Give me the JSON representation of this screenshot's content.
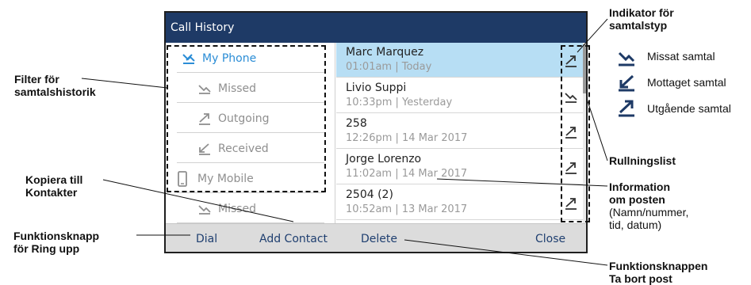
{
  "screen": {
    "title": "Call History",
    "filters": [
      {
        "label": "My Phone",
        "icon": "all-calls-icon",
        "active": true
      },
      {
        "label": "Missed",
        "icon": "missed-call-icon",
        "active": false
      },
      {
        "label": "Outgoing",
        "icon": "outgoing-call-icon",
        "active": false
      },
      {
        "label": "Received",
        "icon": "received-call-icon",
        "active": false
      },
      {
        "label": "My Mobile",
        "icon": "mobile-phone-icon",
        "active": false
      },
      {
        "label": "Missed",
        "icon": "missed-call-icon",
        "active": false
      }
    ],
    "entries": [
      {
        "name": "Marc Marquez",
        "meta": "01:01am | Today",
        "type": "outgoing",
        "selected": true
      },
      {
        "name": "Livio Suppi",
        "meta": "10:33pm | Yesterday",
        "type": "missed",
        "selected": false
      },
      {
        "name": "258",
        "meta": "12:26pm | 14 Mar 2017",
        "type": "outgoing",
        "selected": false
      },
      {
        "name": "Jorge Lorenzo",
        "meta": "11:02am | 14 Mar 2017",
        "type": "outgoing",
        "selected": false
      },
      {
        "name": "2504 (2)",
        "meta": "10:52am | 13 Mar 2017",
        "type": "outgoing",
        "selected": false
      }
    ],
    "softkeys": {
      "dial": "Dial",
      "add_contact": "Add Contact",
      "delete": "Delete",
      "close": "Close"
    }
  },
  "callouts": {
    "filter": [
      "Filter för",
      "samtalshistorik"
    ],
    "copy": [
      "Kopiera till",
      "Kontakter"
    ],
    "dial": [
      "Funktionsknapp",
      "för Ring upp"
    ],
    "indicator": [
      "Indikator för",
      "samtalstyp"
    ],
    "scrollbar": "Rullningslist",
    "info": [
      "Information",
      "om posten"
    ],
    "info_sub": [
      "(Namn/nummer,",
      "tid, datum)"
    ],
    "delete": [
      "Funktionsknappen",
      "Ta bort post"
    ]
  },
  "legend": [
    {
      "label": "Missat samtal",
      "icon": "missed-call-icon"
    },
    {
      "label": "Mottaget samtal",
      "icon": "received-call-icon"
    },
    {
      "label": "Utgående samtal",
      "icon": "outgoing-call-icon"
    }
  ],
  "colors": {
    "title_bar": "#1e3a66",
    "selected_row": "#b7def4",
    "active_filter": "#2b8dd6",
    "softkey_text": "#1f3f70",
    "legend_icon": "#1e3a66"
  }
}
